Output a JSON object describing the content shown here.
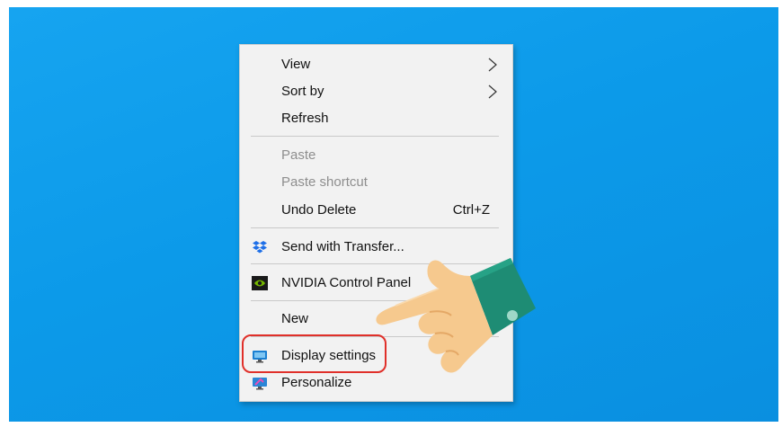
{
  "context_menu": {
    "items": [
      {
        "label": "View",
        "submenu": true
      },
      {
        "label": "Sort by",
        "submenu": true
      },
      {
        "label": "Refresh"
      },
      {
        "label": "Paste",
        "disabled": true
      },
      {
        "label": "Paste shortcut",
        "disabled": true
      },
      {
        "label": "Undo Delete",
        "shortcut": "Ctrl+Z"
      },
      {
        "label": "Send with Transfer...",
        "icon": "dropbox-icon"
      },
      {
        "label": "NVIDIA Control Panel",
        "icon": "nvidia-icon"
      },
      {
        "label": "New",
        "submenu": true
      },
      {
        "label": "Display settings",
        "icon": "display-icon",
        "highlighted": true
      },
      {
        "label": "Personalize",
        "icon": "personalize-icon"
      }
    ]
  },
  "colors": {
    "desktop": "#0c9ae9",
    "menu_bg": "#f2f2f2",
    "highlight_ring": "#e0302a",
    "dropbox": "#1e6fe8",
    "nvidia": "#76b900"
  }
}
